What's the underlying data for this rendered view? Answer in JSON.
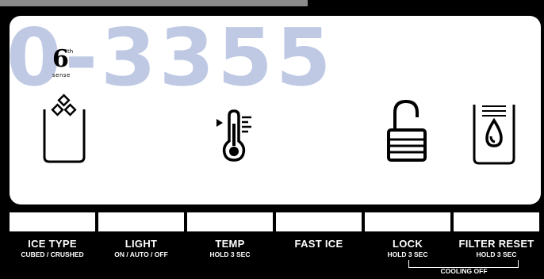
{
  "watermark": "0-3355",
  "logo": {
    "number": "6",
    "superscript": "th",
    "word": "sense"
  },
  "icons": [
    "ice-cup-icon",
    "thermometer-icon",
    "padlock-icon",
    "filter-cup-icon"
  ],
  "controls": [
    {
      "label": "ICE TYPE",
      "sub": "CUBED / CRUSHED"
    },
    {
      "label": "LIGHT",
      "sub": "ON / AUTO / OFF"
    },
    {
      "label": "TEMP",
      "sub": "HOLD 3 SEC"
    },
    {
      "label": "FAST ICE",
      "sub": ""
    },
    {
      "label": "LOCK",
      "sub": "HOLD 3 SEC"
    },
    {
      "label": "FILTER RESET",
      "sub": "HOLD 3 SEC"
    }
  ],
  "cooling_off": "COOLING OFF"
}
